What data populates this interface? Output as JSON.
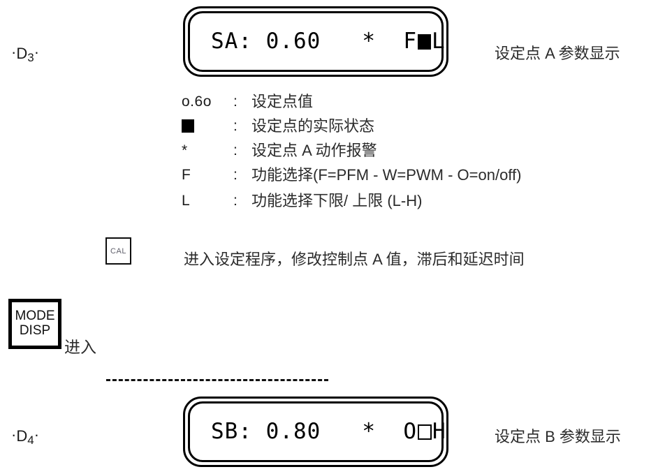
{
  "steps": {
    "d3": {
      "dot_left": "·",
      "letter": "D",
      "number": "3",
      "dot_right": "·"
    },
    "d4": {
      "dot_left": "·",
      "letter": "D",
      "number": "4",
      "dot_right": "·"
    }
  },
  "display_a": {
    "label": "SA:",
    "value": "0.60",
    "alarm": "*",
    "function_code": "F",
    "state_square": "filled",
    "limit_code": "L",
    "caption": "设定点 A 参数显示"
  },
  "display_b": {
    "label": "SB:",
    "value": "0.80",
    "alarm": "*",
    "function_code": "O",
    "state_square": "hollow",
    "limit_code": "H",
    "caption": "设定点 B 参数显示"
  },
  "legend": {
    "separator": ":",
    "rows": [
      {
        "symbol": "o.6o",
        "symbol_type": "text",
        "description": "设定点值"
      },
      {
        "symbol": "",
        "symbol_type": "filled-square",
        "description": "设定点的实际状态"
      },
      {
        "symbol": "*",
        "symbol_type": "text",
        "description": "设定点 A 动作报警"
      },
      {
        "symbol": "F",
        "symbol_type": "text",
        "description": "功能选择(F=PFM - W=PWM - O=on/off)"
      },
      {
        "symbol": "L",
        "symbol_type": "text",
        "description": "功能选择下限/ 上限 (L-H)"
      }
    ]
  },
  "cal_action": {
    "button_label": "CAL",
    "description": "进入设定程序，修改控制点 A 值，滞后和延迟时间"
  },
  "mode_action": {
    "button_line1": "MODE",
    "button_line2": "DISP",
    "description": "进入"
  },
  "colors": {
    "ink": "#000000",
    "text_gray": "#2b2b2b",
    "cal_label": "#5f5f6b"
  }
}
